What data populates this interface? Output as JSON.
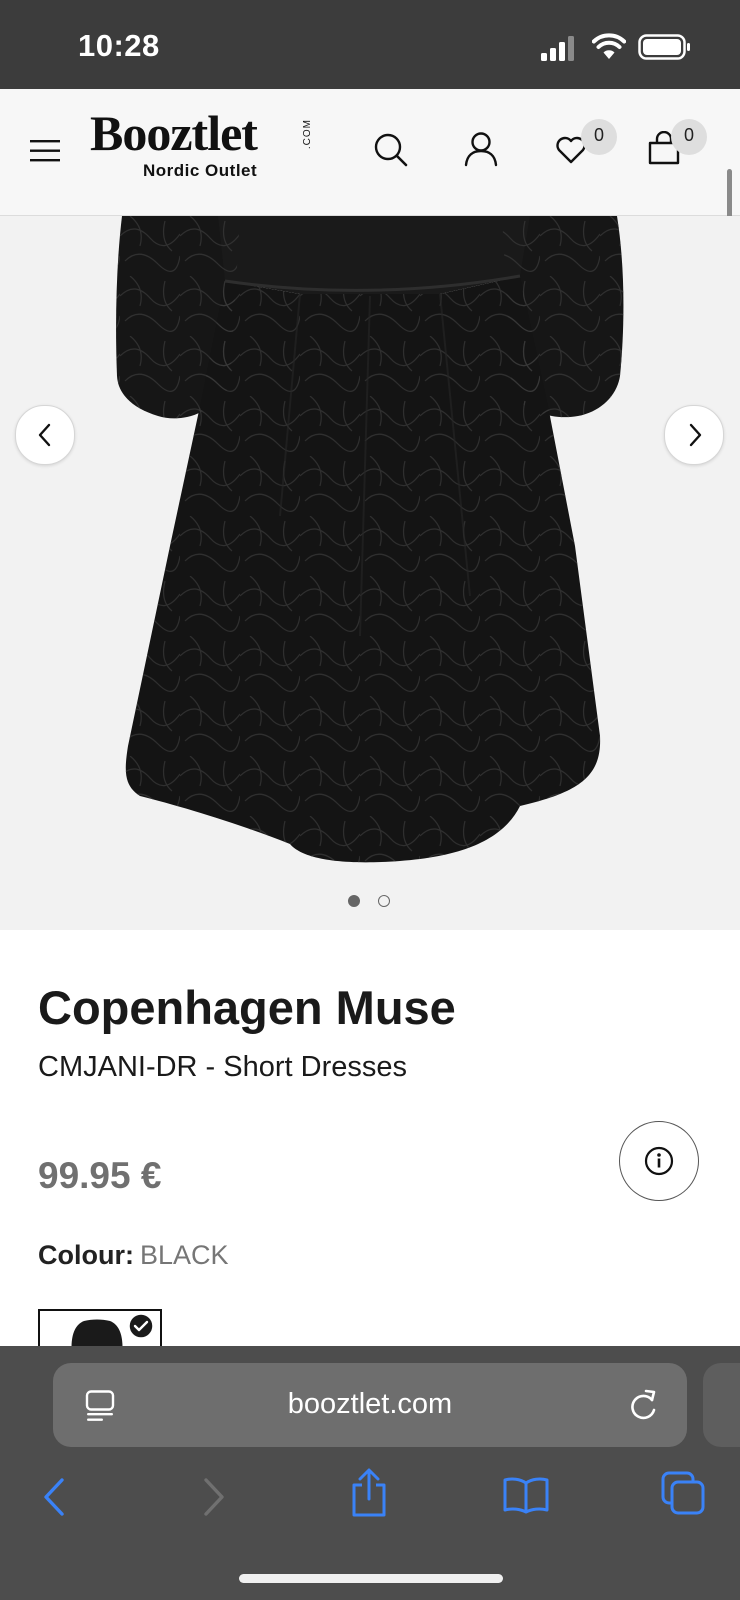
{
  "status_bar": {
    "time": "10:28"
  },
  "header": {
    "logo_text": "Booztlet",
    "logo_com": ".COM",
    "logo_subtitle": "Nordic Outlet",
    "wishlist_count": "0",
    "cart_count": "0"
  },
  "gallery": {
    "slide_count": 2,
    "active_slide": 1
  },
  "product": {
    "brand": "Copenhagen Muse",
    "name": "CMJANI-DR - Short Dresses",
    "price": "99.95 €",
    "colour_label": "Colour:",
    "colour_value": "BLACK"
  },
  "browser": {
    "url": "booztlet.com"
  },
  "colors": {
    "status_bar_bg": "#3c3c3c",
    "header_bg": "#f7f7f7",
    "gallery_bg": "#f2f2f2",
    "price_text": "#707070",
    "browser_toolbar_bg": "#4d4d4d",
    "toolbar_icon_blue": "#3a82f7"
  }
}
